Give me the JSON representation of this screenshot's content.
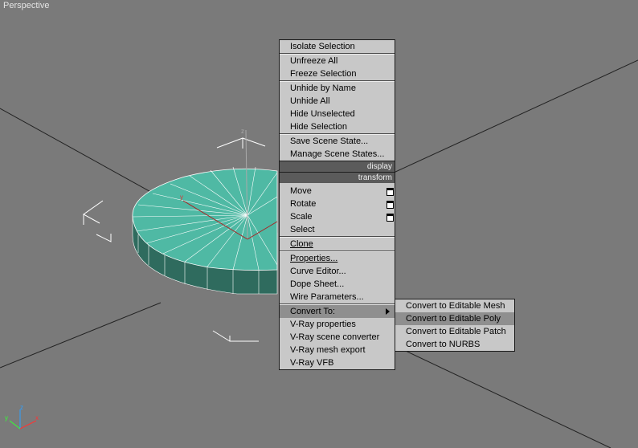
{
  "viewport": {
    "label": "Perspective"
  },
  "quad_menu": {
    "display_section": [
      {
        "label": "Isolate Selection"
      },
      {
        "label": "Unfreeze All"
      },
      {
        "label": "Freeze Selection"
      },
      {
        "label": "Unhide by Name"
      },
      {
        "label": "Unhide All"
      },
      {
        "label": "Hide Unselected"
      },
      {
        "label": "Hide Selection"
      },
      {
        "label": "Save Scene State..."
      },
      {
        "label": "Manage Scene States..."
      }
    ],
    "display_header": "display",
    "transform_header": "transform",
    "transform_section": [
      {
        "label": "Move"
      },
      {
        "label": "Rotate"
      },
      {
        "label": "Scale"
      },
      {
        "label": "Select"
      },
      {
        "label": "Clone"
      },
      {
        "label": "Properties..."
      },
      {
        "label": "Curve Editor..."
      },
      {
        "label": "Dope Sheet..."
      },
      {
        "label": "Wire Parameters..."
      },
      {
        "label": "Convert To:"
      },
      {
        "label": "V-Ray properties"
      },
      {
        "label": "V-Ray scene converter"
      },
      {
        "label": "V-Ray mesh export"
      },
      {
        "label": "V-Ray VFB"
      }
    ]
  },
  "convert_submenu": [
    {
      "label": "Convert to Editable Mesh"
    },
    {
      "label": "Convert to Editable Poly"
    },
    {
      "label": "Convert to Editable Patch"
    },
    {
      "label": "Convert to NURBS"
    }
  ],
  "axis_labels": {
    "x": "x",
    "y": "y",
    "z": "z"
  },
  "colors": {
    "viewport_bg": "#7a7a7a",
    "cylinder_top": "#4fb9a4",
    "cylinder_side": "#2f6b5e",
    "menu_bg": "#c8c8c8",
    "menu_header_bg": "#5b5b5b",
    "highlight_bg": "#8f8f8f"
  },
  "icons": [
    "options-box-icon",
    "submenu-arrow-icon",
    "world-axis-icon",
    "move-gizmo-icon"
  ]
}
